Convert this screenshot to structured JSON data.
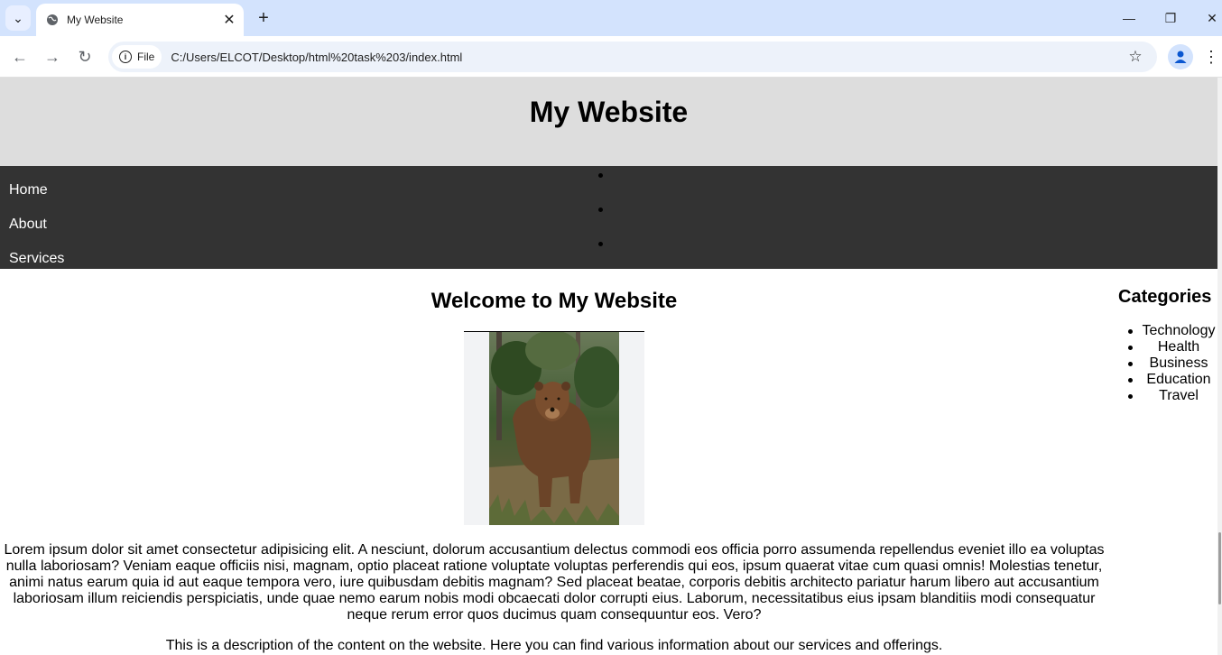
{
  "browser": {
    "tab_title": "My Website",
    "site_chip_label": "File",
    "url": "C:/Users/ELCOT/Desktop/html%20task%203/index.html"
  },
  "site": {
    "header_title": "My Website",
    "nav": [
      "Home",
      "About",
      "Services"
    ],
    "main_heading": "Welcome to My Website",
    "image_description": "brown bear standing in forest",
    "lorem": "Lorem ipsum dolor sit amet consectetur adipisicing elit. A nesciunt, dolorum accusantium delectus commodi eos officia porro assumenda repellendus eveniet illo ea voluptas nulla laboriosam? Veniam eaque officiis nisi, magnam, optio placeat ratione voluptate voluptas perferendis qui eos, ipsum quaerat vitae cum quasi omnis! Molestias tenetur, animi natus earum quia id aut eaque tempora vero, iure quibusdam debitis magnam? Sed placeat beatae, corporis debitis architecto pariatur harum libero aut accusantium laboriosam illum reiciendis perspiciatis, unde quae nemo earum nobis modi obcaecati dolor corrupti eius. Laborum, necessitatibus eius ipsam blanditiis modi consequatur neque rerum error quos ducimus quam consequuntur eos. Vero?",
    "description": "This is a description of the content on the website. Here you can find various information about our services and offerings.",
    "aside_title": "Categories",
    "categories": [
      "Technology",
      "Health",
      "Business",
      "Education",
      "Travel"
    ]
  },
  "colors": {
    "header_bg": "#dddddd",
    "nav_bg": "#333333",
    "tabbar_bg": "#d3e3fd"
  }
}
